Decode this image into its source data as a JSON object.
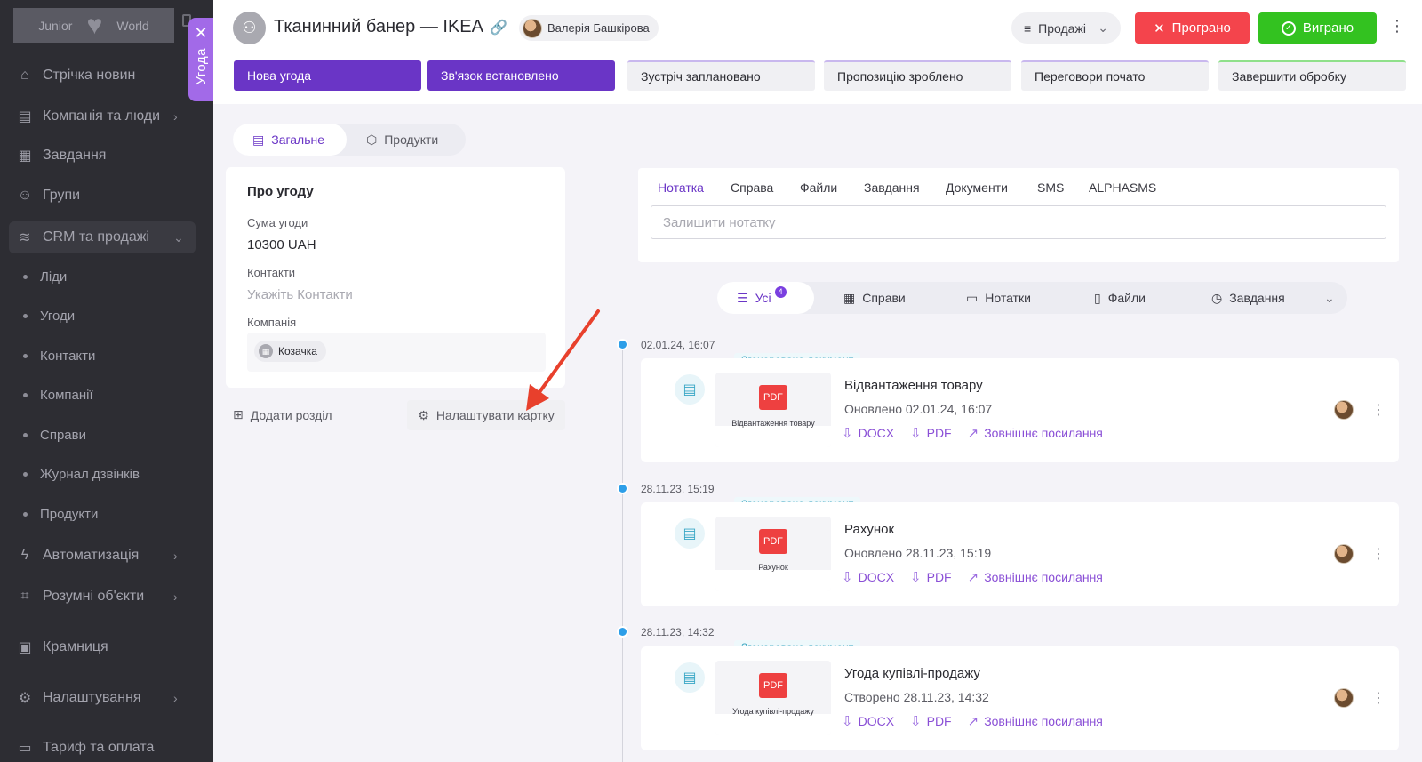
{
  "sidebar": {
    "logo_left": "Junior",
    "logo_right": "World",
    "items": [
      {
        "label": "Стрічка новин",
        "icon": "home-icon"
      },
      {
        "label": "Компанія та люди",
        "icon": "building-icon"
      },
      {
        "label": "Завдання",
        "icon": "calendar-icon"
      },
      {
        "label": "Групи",
        "icon": "users-icon"
      },
      {
        "label": "CRM та продажі",
        "icon": "database-icon"
      },
      {
        "label": "Автоматизація",
        "icon": "bolt-icon"
      },
      {
        "label": "Розумні об'єкти",
        "icon": "scan-icon"
      },
      {
        "label": "Крамниця",
        "icon": "store-icon"
      },
      {
        "label": "Налаштування",
        "icon": "gear-icon"
      },
      {
        "label": "Тариф та оплата",
        "icon": "wallet-icon"
      }
    ],
    "crm_sub": [
      "Ліди",
      "Угоди",
      "Контакти",
      "Компанії",
      "Справи",
      "Журнал дзвінків",
      "Продукти"
    ]
  },
  "side_tab": {
    "label": "Угода"
  },
  "header": {
    "title": "Тканинний банер — IKEA",
    "owner": "Валерія Башкірова",
    "pipeline": "Продажі",
    "lost_label": "Програно",
    "won_label": "Виграно",
    "stages": [
      {
        "label": "Нова угода",
        "done": true
      },
      {
        "label": "Зв'язок встановлено",
        "done": true
      },
      {
        "label": "Зустріч заплановано",
        "done": false
      },
      {
        "label": "Пропозицію зроблено",
        "done": false
      },
      {
        "label": "Переговори почато",
        "done": false
      },
      {
        "label": "Завершити обробку",
        "done": false
      }
    ]
  },
  "left": {
    "tabs": [
      "Загальне",
      "Продукти"
    ],
    "about": {
      "title": "Про угоду",
      "amount_label": "Сума угоди",
      "amount_value": "10300 UAH",
      "contacts_label": "Контакти",
      "contacts_placeholder": "Укажіть Контакти",
      "company_label": "Компанія",
      "company_value": "Козачка"
    },
    "add_section": "Додати розділ",
    "configure_card": "Налаштувати картку"
  },
  "composer": {
    "tabs": [
      "Нотатка",
      "Справа",
      "Файли",
      "Завдання",
      "Документи",
      "SMS",
      "ALPHASMS"
    ],
    "placeholder": "Залишити нотатку"
  },
  "timeline_filter": {
    "all": "Усі",
    "all_count": "4",
    "items": [
      "Справи",
      "Нотатки",
      "Файли",
      "Завдання"
    ]
  },
  "timeline": [
    {
      "date": "02.01.24, 16:07",
      "badge": "Згенеровано документ",
      "name": "Відвантаження товару",
      "meta": "Оновлено 02.01.24, 16:07",
      "thumb_caption": "Відвантаження товару"
    },
    {
      "date": "28.11.23, 15:19",
      "badge": "Згенеровано документ",
      "name": "Рахунок",
      "meta": "Оновлено 28.11.23, 15:19",
      "thumb_caption": "Рахунок"
    },
    {
      "date": "28.11.23, 14:32",
      "badge": "Згенеровано документ",
      "name": "Угода купівлі-продажу",
      "meta": "Створено 28.11.23, 14:32",
      "thumb_caption": "Угода купівлі-продажу"
    }
  ],
  "doc_actions": {
    "docx": "DOCX",
    "pdf": "PDF",
    "external": "Зовнішнє посилання",
    "pdf_badge": "PDF"
  },
  "colors": {
    "accent": "#6a35c6",
    "lost": "#f4444c",
    "won": "#33c220",
    "timeline_dot": "#2d9ee8",
    "arrow": "#e8402c"
  }
}
